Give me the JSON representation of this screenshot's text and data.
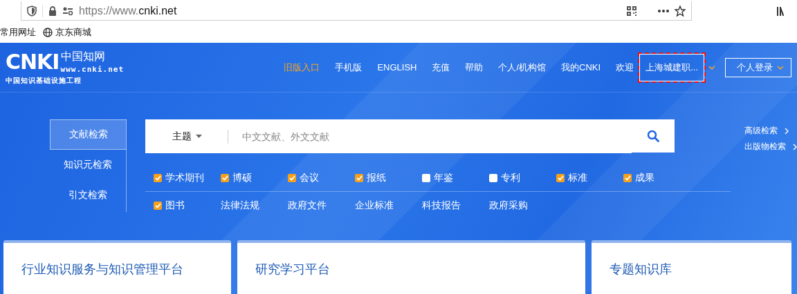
{
  "browser": {
    "url_prefix": "https://www.",
    "url_domain": "cnki.net",
    "bookmarks": [
      {
        "label": "常用网址",
        "kind": "text"
      },
      {
        "label": "京东商城",
        "kind": "globe"
      }
    ]
  },
  "logo": {
    "mark": "CNKI",
    "name": "中国知网",
    "site": "www.cnki.net",
    "slogan": "中国知识基础设施工程"
  },
  "nav": [
    {
      "label": "旧版入口",
      "color": "#f5a623"
    },
    {
      "label": "手机版",
      "color": "#ffffff"
    },
    {
      "label": "ENGLISH",
      "color": "#ffffff"
    },
    {
      "label": "充值",
      "color": "#ffffff"
    },
    {
      "label": "帮助",
      "color": "#ffffff"
    },
    {
      "label": "个人/机构馆",
      "color": "#ffffff"
    },
    {
      "label": "我的CNKI",
      "color": "#ffffff"
    }
  ],
  "welcome": {
    "label": "欢迎",
    "institution": "上海城建职...",
    "outlined": true
  },
  "login_button": "个人登录",
  "search_tabs": [
    {
      "label": "文献检索",
      "selected": true
    },
    {
      "label": "知识元检索",
      "selected": false
    },
    {
      "label": "引文检索",
      "selected": false
    }
  ],
  "search": {
    "field_select": "主题",
    "placeholder": "中文文献、外文文献"
  },
  "side_links": [
    "高级检索",
    "出版物检索"
  ],
  "source_rows": [
    [
      {
        "kind": "checkbox",
        "label": "学术期刊",
        "checked": true
      },
      {
        "kind": "checkbox",
        "label": "博硕",
        "checked": true
      },
      {
        "kind": "checkbox",
        "label": "会议",
        "checked": true
      },
      {
        "kind": "checkbox",
        "label": "报纸",
        "checked": true
      },
      {
        "kind": "checkbox",
        "label": "年鉴",
        "checked": false
      },
      {
        "kind": "checkbox",
        "label": "专利",
        "checked": false
      },
      {
        "kind": "checkbox",
        "label": "标准",
        "checked": true
      },
      {
        "kind": "checkbox",
        "label": "成果",
        "checked": true
      }
    ],
    [
      {
        "kind": "checkbox",
        "label": "图书",
        "checked": true
      },
      {
        "kind": "link",
        "label": "法律法规"
      },
      {
        "kind": "link",
        "label": "政府文件"
      },
      {
        "kind": "link",
        "label": "企业标准"
      },
      {
        "kind": "link",
        "label": "科技报告"
      },
      {
        "kind": "link",
        "label": "政府采购"
      }
    ]
  ],
  "platform_cards": [
    {
      "title": "行业知识服务与知识管理平台"
    },
    {
      "title": "研究学习平台"
    },
    {
      "title": "专题知识库"
    }
  ]
}
